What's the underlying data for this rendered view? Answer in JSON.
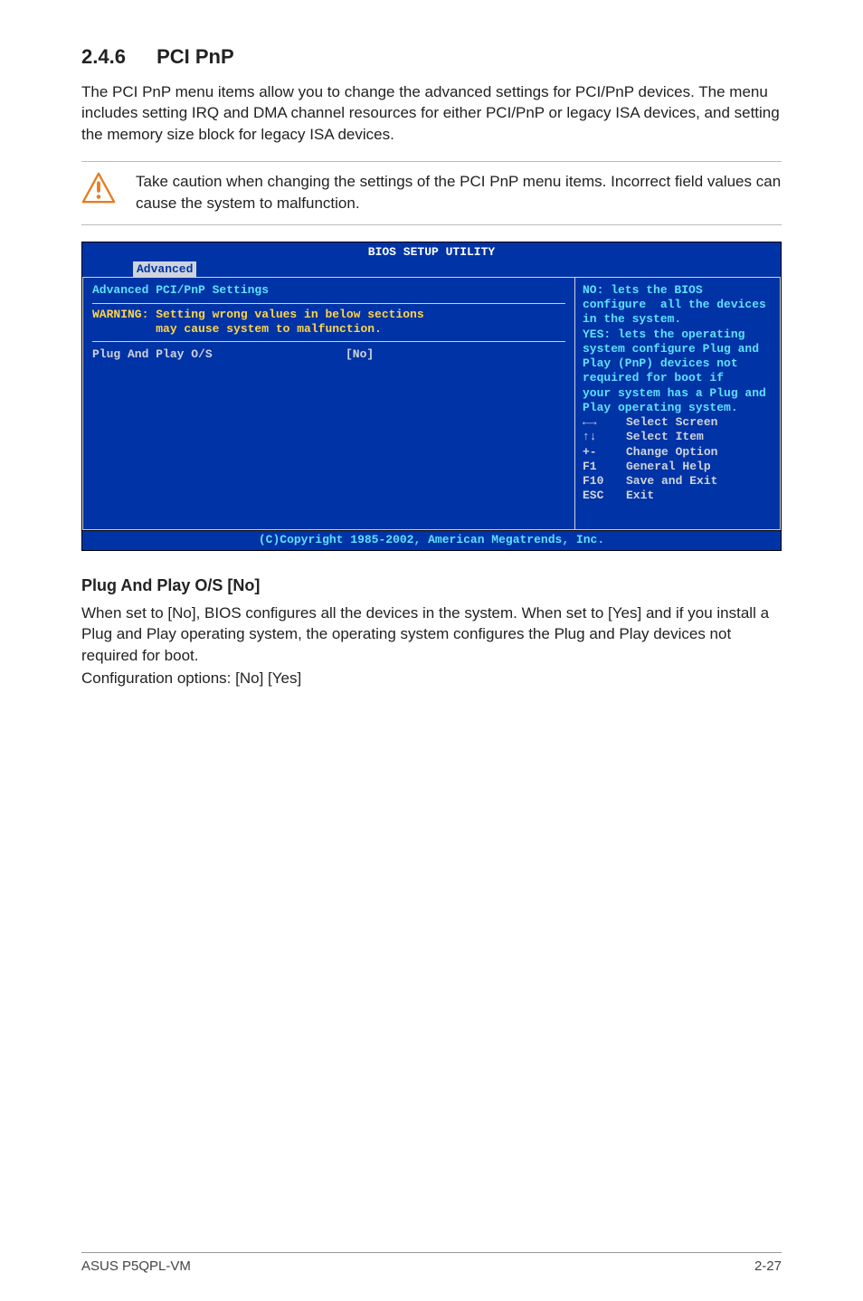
{
  "section": {
    "number": "2.4.6",
    "title": "PCI PnP"
  },
  "intro": "The PCI PnP menu items allow you to change the advanced settings for PCI/PnP devices. The menu includes setting IRQ and DMA channel resources for either PCI/PnP or legacy ISA devices, and setting the memory size block for legacy ISA devices.",
  "callout": "Take caution when changing the settings of the PCI PnP menu items. Incorrect field values can cause the system to malfunction.",
  "bios": {
    "title": "BIOS SETUP UTILITY",
    "tab": "Advanced",
    "left": {
      "heading": "Advanced PCI/PnP Settings",
      "warning": "WARNING: Setting wrong values in below sections\n         may cause system to malfunction.",
      "item_label": "Plug And Play O/S",
      "item_value": "[No]"
    },
    "right": {
      "help": "NO: lets the BIOS configure  all the devices in the system.\nYES: lets the operating system configure Plug and Play (PnP) devices not required for boot if\nyour system has a Plug and Play operating system.",
      "keys": [
        {
          "k": "←→",
          "d": "Select Screen"
        },
        {
          "k": "↑↓",
          "d": "Select Item"
        },
        {
          "k": "+-",
          "d": "Change Option"
        },
        {
          "k": "F1",
          "d": "General Help"
        },
        {
          "k": "F10",
          "d": "Save and Exit"
        },
        {
          "k": "ESC",
          "d": "Exit"
        }
      ]
    },
    "footer": "(C)Copyright 1985-2002, American Megatrends, Inc."
  },
  "sub": {
    "heading": "Plug And Play O/S [No]",
    "p1": "When set to [No], BIOS configures all the devices in the system. When set to [Yes] and if you install a Plug and Play operating system, the operating system configures the Plug and Play devices not required for boot.",
    "p2": "Configuration options: [No] [Yes]"
  },
  "footer": {
    "left": "ASUS P5QPL-VM",
    "right": "2-27"
  }
}
